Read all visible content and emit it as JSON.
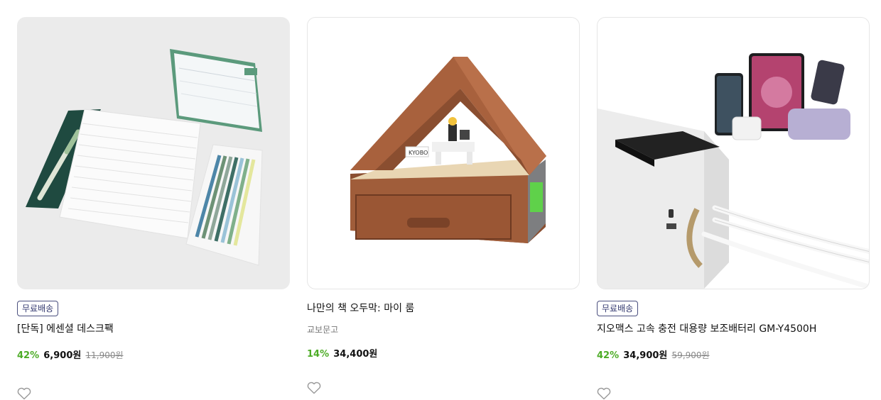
{
  "products": [
    {
      "badge": "무료배송",
      "title": "[단독] 에센셜 데스크팩",
      "discount_rate": "42%",
      "price": "6,900원",
      "original_price": "11,900원"
    },
    {
      "title": "나만의 책 오두막: 마이 룸",
      "publisher": "교보문고",
      "discount_rate": "14%",
      "price": "34,400원"
    },
    {
      "badge": "무료배송",
      "title": "지오맥스 고속 충전 대용량 보조배터리 GM-Y4500H",
      "discount_rate": "42%",
      "price": "34,900원",
      "original_price": "59,900원"
    }
  ],
  "image_text": {
    "kyobo_sign": "KYOBO"
  },
  "colors": {
    "discount": "#4dac27",
    "badge_border": "#4a4f7e"
  }
}
